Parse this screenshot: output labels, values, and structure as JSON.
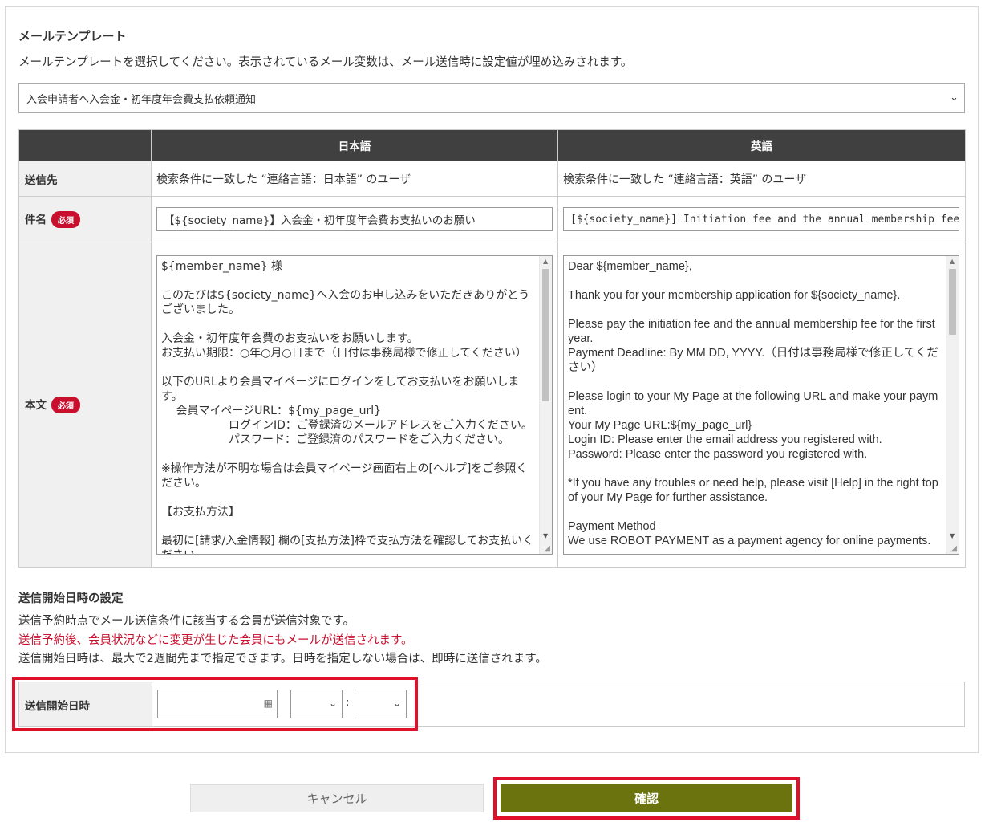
{
  "mail_template": {
    "title": "メールテンプレート",
    "description": "メールテンプレートを選択してください。表示されているメール変数は、メール送信時に設定値が埋め込みされます。",
    "selected": "入会申請者へ入会金・初年度年会費支払依頼通知",
    "headers": [
      "日本語",
      "英語"
    ],
    "rows": {
      "recipient_label": "送信先",
      "recipient_ja": "検索条件に一致した “連絡言語：日本語” のユーザ",
      "recipient_en": "検索条件に一致した “連絡言語：英語” のユーザ",
      "subject_label": "件名",
      "subject_ja": "【${society_name}】入会金・初年度年会費お支払いのお願い",
      "subject_en": "[${society_name}] Initiation fee and the annual membership fee for the first year",
      "body_label": "本文",
      "required_badge": "必須",
      "body_ja": "${member_name} 様\n\nこのたびは${society_name}へ入会のお申し込みをいただきありがとうございました。\n\n入会金・初年度年会費のお支払いをお願いします。\nお支払い期限：○年○月○日まで（日付は事務局様で修正してください）\n\n以下のURLより会員マイページにログインをしてお支払いをお願いします。\n　 会員マイページURL：${my_page_url}\n　　　　　　ログインID：ご登録済のメールアドレスをご入力ください。\n　　　　　　パスワード：ご登録済のパスワードをご入力ください。\n\n※操作方法が不明な場合は会員マイページ画面右上の[ヘルプ]をご参照ください。\n\n【お支払方法】\n\n最初に[請求/入金情報] 欄の[支払方法]枠で支払方法を確認してお支払いください。",
      "body_en": "Dear ${member_name},\n\nThank you for your membership application for ${society_name}.\n\nPlease pay the initiation fee and the annual membership fee for the first year.\nPayment Deadline: By MM DD, YYYY.（日付は事務局様で修正してください）\n\nPlease login to your My Page at the following URL and make your payment.\nYour My Page URL:${my_page_url}\nLogin ID: Please enter the email address you registered with.\nPassword: Please enter the password you registered with.\n\n*If you have any troubles or need help, please visit [Help] in the right top of your My Page for further assistance.\n\nPayment Method\nWe use ROBOT PAYMENT as a payment agency for online payments."
    }
  },
  "send_schedule": {
    "title": "送信開始日時の設定",
    "line1": "送信予約時点でメール送信条件に該当する会員が送信対象です。",
    "line2_warning": "送信予約後、会員状況などに変更が生じた会員にもメールが送信されます。",
    "line3": "送信開始日時は、最大で2週間先まで指定できます。日時を指定しない場合は、即時に送信されます。",
    "field_label": "送信開始日時",
    "date_value": "",
    "colon": ":"
  },
  "buttons": {
    "cancel": "キャンセル",
    "confirm": "確認"
  },
  "colors": {
    "header_bg": "#404040",
    "required_badge": "#c8102e",
    "warning_text": "#c8102e",
    "confirm_button": "#6b730e",
    "highlight_border": "#e0102a"
  }
}
